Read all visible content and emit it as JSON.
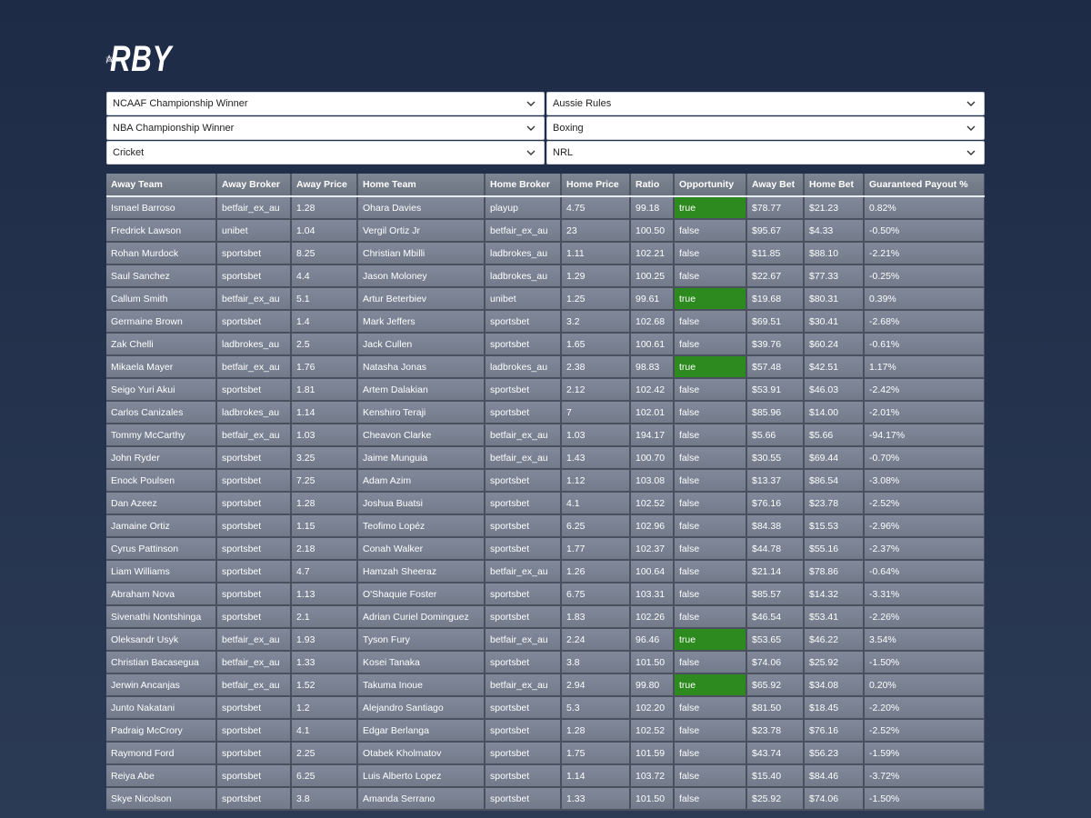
{
  "brand": {
    "logo_text": "RBY"
  },
  "selects": [
    {
      "value": "NCAAF Championship Winner"
    },
    {
      "value": "Aussie Rules"
    },
    {
      "value": "NBA Championship Winner"
    },
    {
      "value": "Boxing"
    },
    {
      "value": "Cricket"
    },
    {
      "value": "NRL"
    }
  ],
  "table": {
    "columns": [
      "Away Team",
      "Away Broker",
      "Away Price",
      "Home Team",
      "Home Broker",
      "Home Price",
      "Ratio",
      "Opportunity",
      "Away Bet",
      "Home Bet",
      "Guaranteed Payout %"
    ],
    "rows": [
      [
        "Ismael Barroso",
        "betfair_ex_au",
        "1.28",
        "Ohara Davies",
        "playup",
        "4.75",
        "99.18",
        "true",
        "$78.77",
        "$21.23",
        "0.82%"
      ],
      [
        "Fredrick Lawson",
        "unibet",
        "1.04",
        "Vergil Ortiz Jr",
        "betfair_ex_au",
        "23",
        "100.50",
        "false",
        "$95.67",
        "$4.33",
        "-0.50%"
      ],
      [
        "Rohan Murdock",
        "sportsbet",
        "8.25",
        "Christian Mbilli",
        "ladbrokes_au",
        "1.11",
        "102.21",
        "false",
        "$11.85",
        "$88.10",
        "-2.21%"
      ],
      [
        "Saul Sanchez",
        "sportsbet",
        "4.4",
        "Jason Moloney",
        "ladbrokes_au",
        "1.29",
        "100.25",
        "false",
        "$22.67",
        "$77.33",
        "-0.25%"
      ],
      [
        "Callum Smith",
        "betfair_ex_au",
        "5.1",
        "Artur Beterbiev",
        "unibet",
        "1.25",
        "99.61",
        "true",
        "$19.68",
        "$80.31",
        "0.39%"
      ],
      [
        "Germaine Brown",
        "sportsbet",
        "1.4",
        "Mark Jeffers",
        "sportsbet",
        "3.2",
        "102.68",
        "false",
        "$69.51",
        "$30.41",
        "-2.68%"
      ],
      [
        "Zak Chelli",
        "ladbrokes_au",
        "2.5",
        "Jack Cullen",
        "sportsbet",
        "1.65",
        "100.61",
        "false",
        "$39.76",
        "$60.24",
        "-0.61%"
      ],
      [
        "Mikaela Mayer",
        "betfair_ex_au",
        "1.76",
        "Natasha Jonas",
        "ladbrokes_au",
        "2.38",
        "98.83",
        "true",
        "$57.48",
        "$42.51",
        "1.17%"
      ],
      [
        "Seigo Yuri Akui",
        "sportsbet",
        "1.81",
        "Artem Dalakian",
        "sportsbet",
        "2.12",
        "102.42",
        "false",
        "$53.91",
        "$46.03",
        "-2.42%"
      ],
      [
        "Carlos Canizales",
        "ladbrokes_au",
        "1.14",
        "Kenshiro Teraji",
        "sportsbet",
        "7",
        "102.01",
        "false",
        "$85.96",
        "$14.00",
        "-2.01%"
      ],
      [
        "Tommy McCarthy",
        "betfair_ex_au",
        "1.03",
        "Cheavon Clarke",
        "betfair_ex_au",
        "1.03",
        "194.17",
        "false",
        "$5.66",
        "$5.66",
        "-94.17%"
      ],
      [
        "John Ryder",
        "sportsbet",
        "3.25",
        "Jaime Munguia",
        "betfair_ex_au",
        "1.43",
        "100.70",
        "false",
        "$30.55",
        "$69.44",
        "-0.70%"
      ],
      [
        "Enock Poulsen",
        "sportsbet",
        "7.25",
        "Adam Azim",
        "sportsbet",
        "1.12",
        "103.08",
        "false",
        "$13.37",
        "$86.54",
        "-3.08%"
      ],
      [
        "Dan Azeez",
        "sportsbet",
        "1.28",
        "Joshua Buatsi",
        "sportsbet",
        "4.1",
        "102.52",
        "false",
        "$76.16",
        "$23.78",
        "-2.52%"
      ],
      [
        "Jamaine Ortiz",
        "sportsbet",
        "1.15",
        "Teofimo Lopéz",
        "sportsbet",
        "6.25",
        "102.96",
        "false",
        "$84.38",
        "$15.53",
        "-2.96%"
      ],
      [
        "Cyrus Pattinson",
        "sportsbet",
        "2.18",
        "Conah Walker",
        "sportsbet",
        "1.77",
        "102.37",
        "false",
        "$44.78",
        "$55.16",
        "-2.37%"
      ],
      [
        "Liam Williams",
        "sportsbet",
        "4.7",
        "Hamzah Sheeraz",
        "betfair_ex_au",
        "1.26",
        "100.64",
        "false",
        "$21.14",
        "$78.86",
        "-0.64%"
      ],
      [
        "Abraham Nova",
        "sportsbet",
        "1.13",
        "O'Shaquie Foster",
        "sportsbet",
        "6.75",
        "103.31",
        "false",
        "$85.57",
        "$14.32",
        "-3.31%"
      ],
      [
        "Sivenathi Nontshinga",
        "sportsbet",
        "2.1",
        "Adrian Curiel Dominguez",
        "sportsbet",
        "1.83",
        "102.26",
        "false",
        "$46.54",
        "$53.41",
        "-2.26%"
      ],
      [
        "Oleksandr Usyk",
        "betfair_ex_au",
        "1.93",
        "Tyson Fury",
        "betfair_ex_au",
        "2.24",
        "96.46",
        "true",
        "$53.65",
        "$46.22",
        "3.54%"
      ],
      [
        "Christian Bacasegua",
        "betfair_ex_au",
        "1.33",
        "Kosei Tanaka",
        "sportsbet",
        "3.8",
        "101.50",
        "false",
        "$74.06",
        "$25.92",
        "-1.50%"
      ],
      [
        "Jerwin Ancanjas",
        "betfair_ex_au",
        "1.52",
        "Takuma Inoue",
        "betfair_ex_au",
        "2.94",
        "99.80",
        "true",
        "$65.92",
        "$34.08",
        "0.20%"
      ],
      [
        "Junto Nakatani",
        "sportsbet",
        "1.2",
        "Alejandro Santiago",
        "sportsbet",
        "5.3",
        "102.20",
        "false",
        "$81.50",
        "$18.45",
        "-2.20%"
      ],
      [
        "Padraig McCrory",
        "sportsbet",
        "4.1",
        "Edgar Berlanga",
        "sportsbet",
        "1.28",
        "102.52",
        "false",
        "$23.78",
        "$76.16",
        "-2.52%"
      ],
      [
        "Raymond Ford",
        "sportsbet",
        "2.25",
        "Otabek Kholmatov",
        "sportsbet",
        "1.75",
        "101.59",
        "false",
        "$43.74",
        "$56.23",
        "-1.59%"
      ],
      [
        "Reiya Abe",
        "sportsbet",
        "6.25",
        "Luis Alberto Lopez",
        "sportsbet",
        "1.14",
        "103.72",
        "false",
        "$15.40",
        "$84.46",
        "-3.72%"
      ],
      [
        "Skye Nicolson",
        "sportsbet",
        "3.8",
        "Amanda Serrano",
        "sportsbet",
        "1.33",
        "101.50",
        "false",
        "$25.92",
        "$74.06",
        "-1.50%"
      ]
    ]
  },
  "colors": {
    "background": "#1d2b47",
    "opportunity_true": "#2c8a1e",
    "cell": "#7b8393"
  },
  "icons": {
    "select_chevron": "chevron-down-icon",
    "logo": "atom-logo-icon"
  }
}
